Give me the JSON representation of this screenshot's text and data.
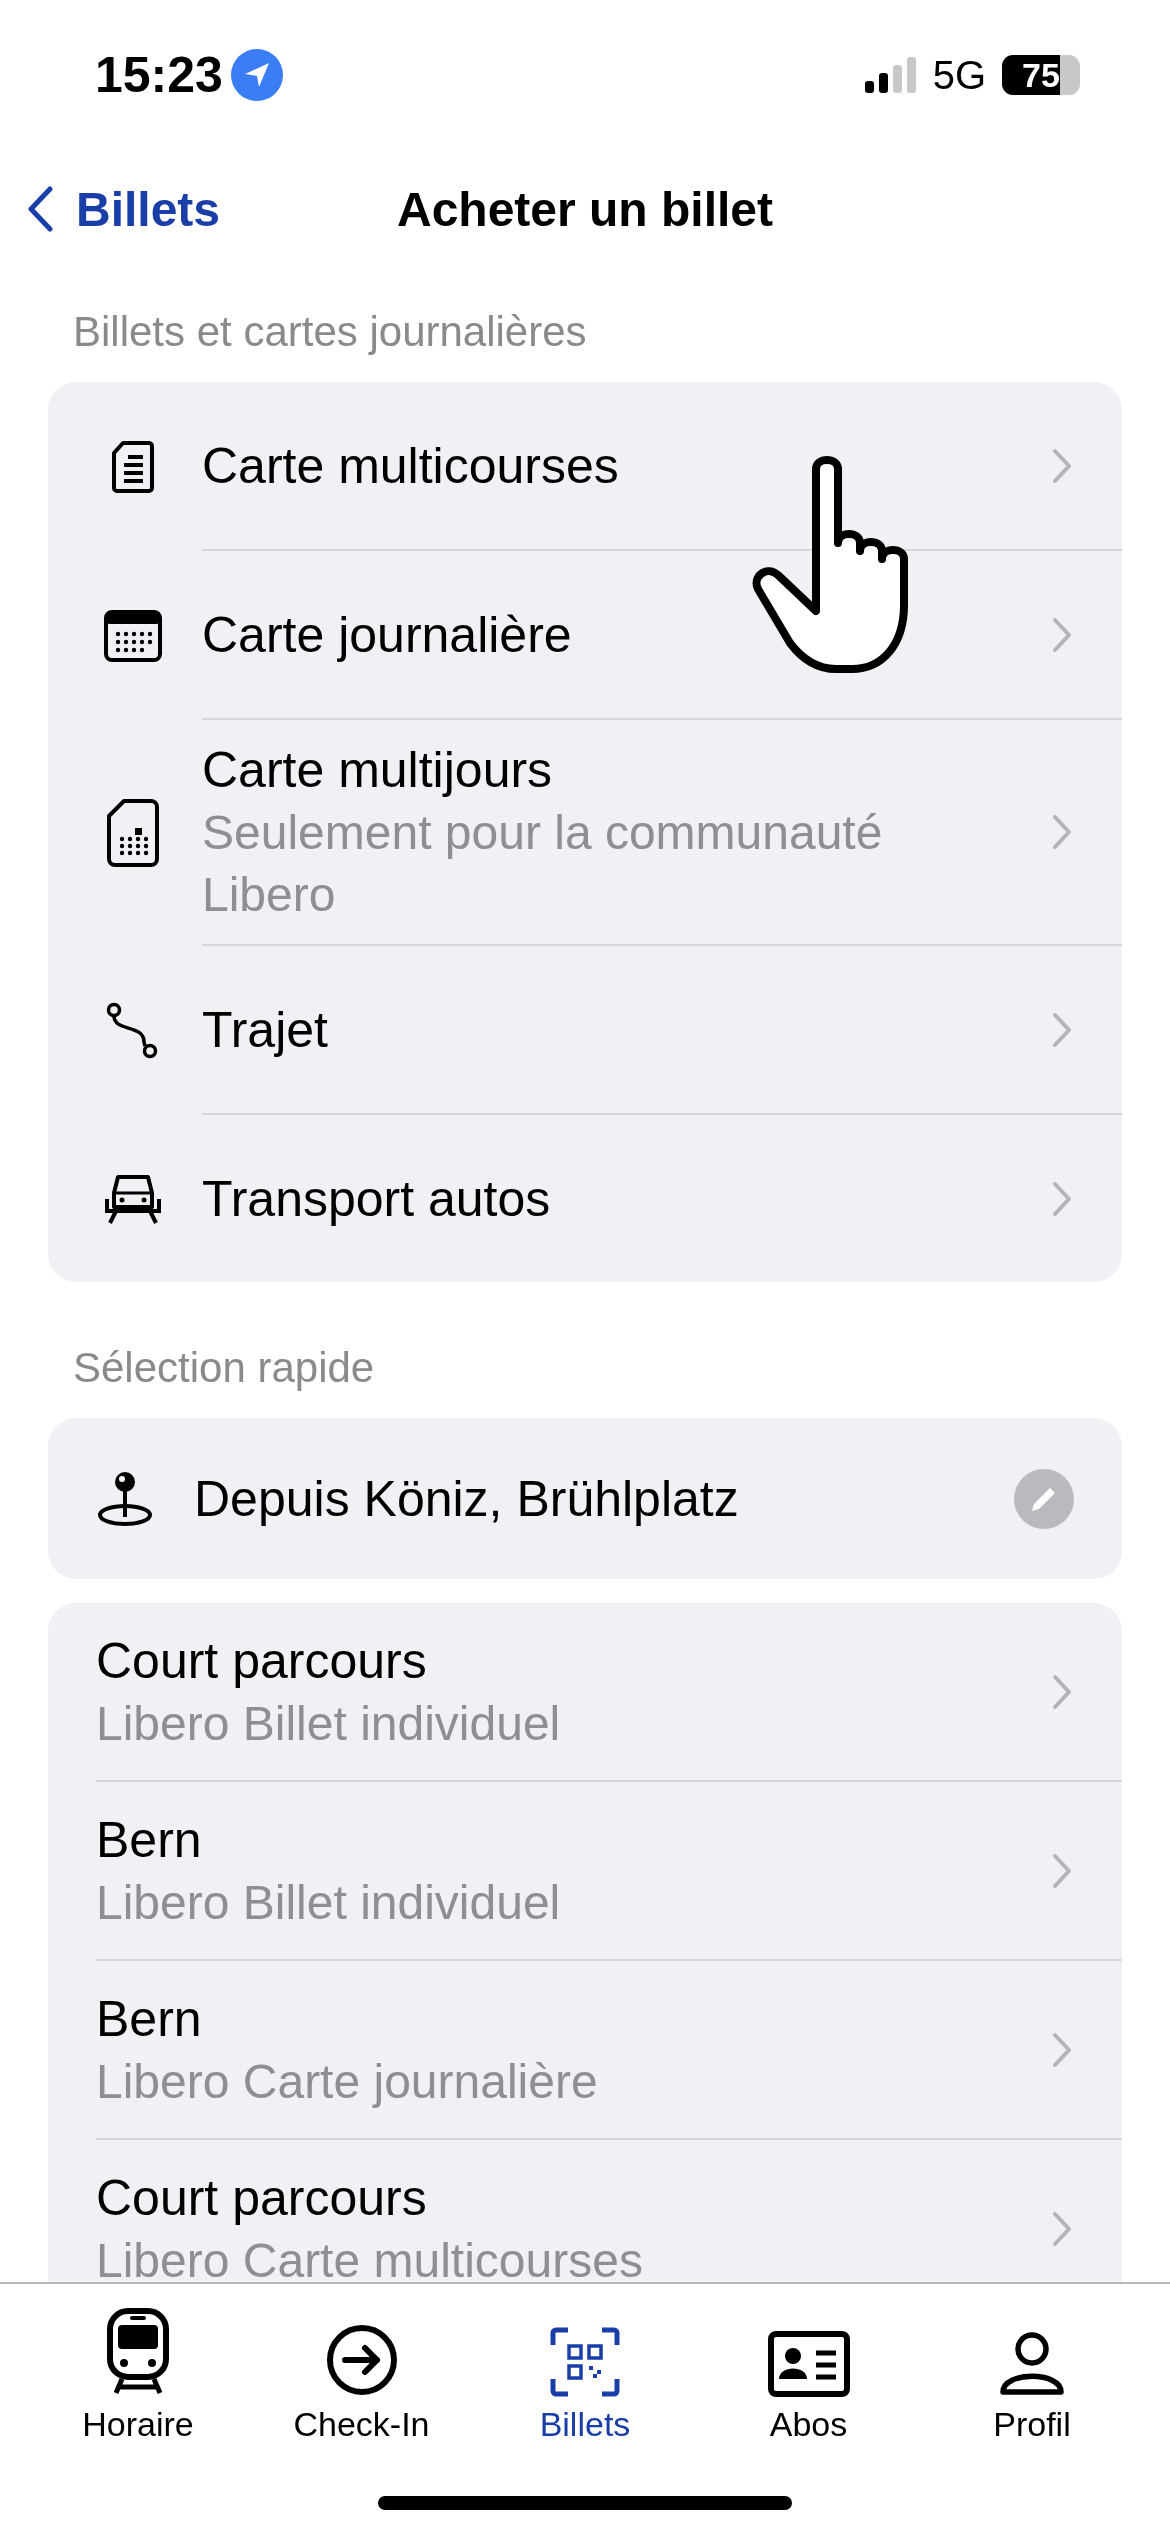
{
  "status_bar": {
    "time": "15:23",
    "network": "5G",
    "battery": "75"
  },
  "nav": {
    "back": "Billets",
    "title": "Acheter un billet"
  },
  "ticket_section": {
    "header": "Billets et cartes journalières",
    "items": [
      {
        "title": "Carte multicourses"
      },
      {
        "title": "Carte journalière"
      },
      {
        "title": "Carte multijours",
        "subtitle": "Seulement pour la communauté Libero"
      },
      {
        "title": "Trajet"
      },
      {
        "title": "Transport autos"
      }
    ]
  },
  "quick_selection": {
    "header": "Sélection rapide",
    "location": "Depuis Köniz, Brühlplatz"
  },
  "favorites": [
    {
      "title": "Court parcours",
      "subtitle": "Libero Billet individuel"
    },
    {
      "title": "Bern",
      "subtitle": "Libero Billet individuel"
    },
    {
      "title": "Bern",
      "subtitle": "Libero Carte journalière"
    },
    {
      "title": "Court parcours",
      "subtitle": "Libero Carte multicourses"
    }
  ],
  "tab_bar": [
    {
      "label": "Horaire",
      "selected": false
    },
    {
      "label": "Check-In",
      "selected": false
    },
    {
      "label": "Billets",
      "selected": true
    },
    {
      "label": "Abos",
      "selected": false
    },
    {
      "label": "Profil",
      "selected": false
    }
  ]
}
